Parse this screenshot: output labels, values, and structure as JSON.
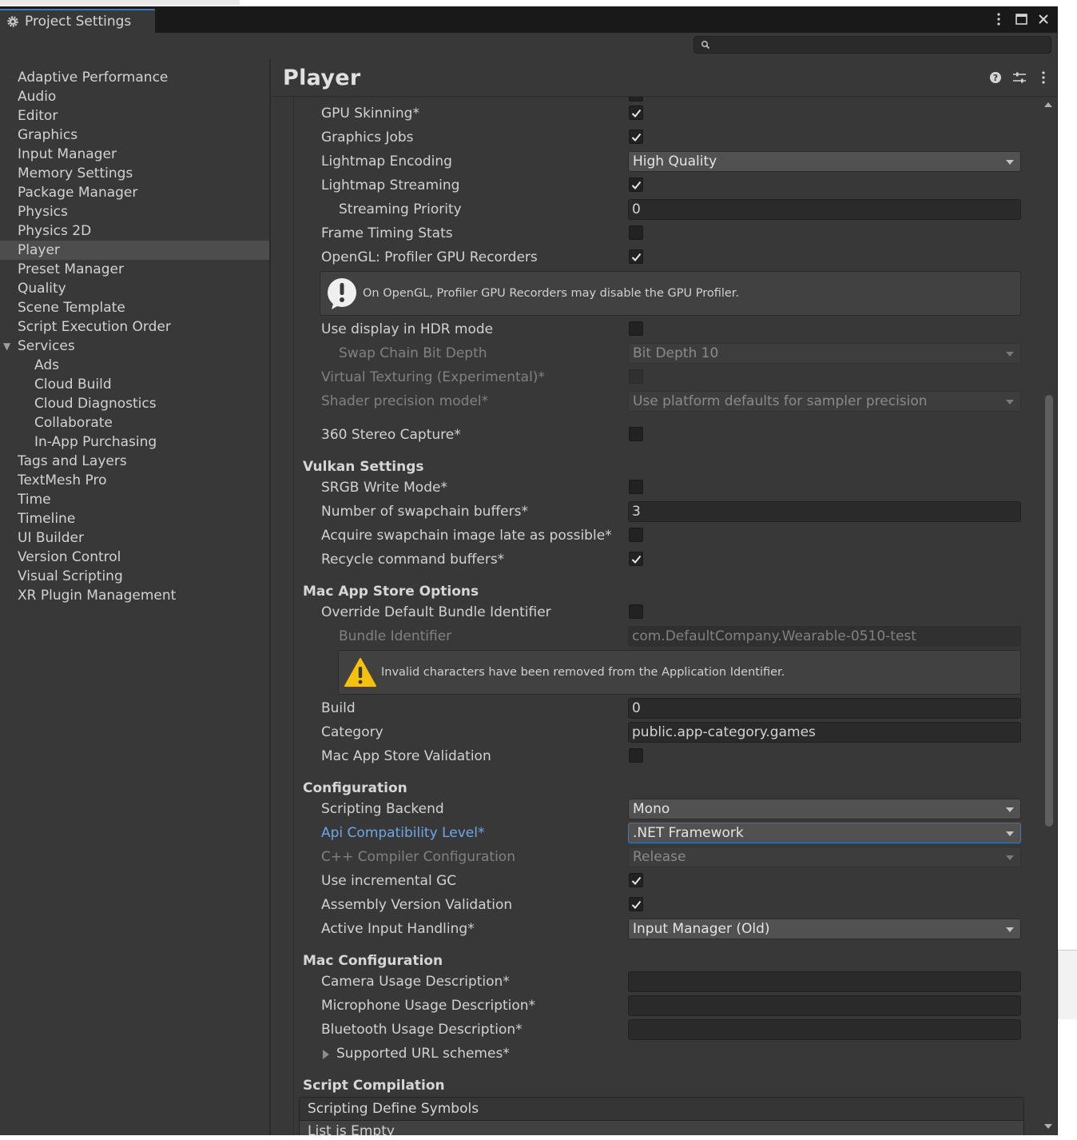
{
  "window": {
    "tab_title": "Project Settings",
    "tab_icon": "gear-icon",
    "controls": [
      "kebab-menu-icon",
      "maximize-icon",
      "close-icon"
    ]
  },
  "search": {
    "placeholder": ""
  },
  "sidebar": {
    "items": [
      {
        "label": "Adaptive Performance"
      },
      {
        "label": "Audio"
      },
      {
        "label": "Editor"
      },
      {
        "label": "Graphics"
      },
      {
        "label": "Input Manager"
      },
      {
        "label": "Memory Settings"
      },
      {
        "label": "Package Manager"
      },
      {
        "label": "Physics"
      },
      {
        "label": "Physics 2D"
      },
      {
        "label": "Player",
        "selected": true
      },
      {
        "label": "Preset Manager"
      },
      {
        "label": "Quality"
      },
      {
        "label": "Scene Template"
      },
      {
        "label": "Script Execution Order"
      },
      {
        "label": "Services",
        "expanded": true
      },
      {
        "label": "Ads",
        "child": true
      },
      {
        "label": "Cloud Build",
        "child": true
      },
      {
        "label": "Cloud Diagnostics",
        "child": true
      },
      {
        "label": "Collaborate",
        "child": true
      },
      {
        "label": "In-App Purchasing",
        "child": true
      },
      {
        "label": "Tags and Layers"
      },
      {
        "label": "TextMesh Pro"
      },
      {
        "label": "Time"
      },
      {
        "label": "Timeline"
      },
      {
        "label": "UI Builder"
      },
      {
        "label": "Version Control"
      },
      {
        "label": "Visual Scripting"
      },
      {
        "label": "XR Plugin Management"
      }
    ]
  },
  "main": {
    "title": "Player",
    "header_icons": [
      "help-icon",
      "preset-icon",
      "kebab-menu-icon"
    ],
    "rows": {
      "gpu_skinning": {
        "label": "GPU Skinning*",
        "checked": true
      },
      "graphics_jobs": {
        "label": "Graphics Jobs",
        "checked": true
      },
      "lightmap_encoding": {
        "label": "Lightmap Encoding",
        "value": "High Quality"
      },
      "lightmap_streaming": {
        "label": "Lightmap Streaming",
        "checked": true
      },
      "streaming_priority": {
        "label": "Streaming Priority",
        "value": "0"
      },
      "frame_timing": {
        "label": "Frame Timing Stats",
        "checked": false
      },
      "opengl_profiler": {
        "label": "OpenGL: Profiler GPU Recorders",
        "checked": true
      },
      "opengl_help": "On OpenGL, Profiler GPU Recorders may disable the GPU Profiler.",
      "hdr_mode": {
        "label": "Use display in HDR mode",
        "checked": false
      },
      "swap_chain": {
        "label": "Swap Chain Bit Depth",
        "value": "Bit Depth 10"
      },
      "virtual_texturing": {
        "label": "Virtual Texturing (Experimental)*",
        "checked": false
      },
      "shader_precision": {
        "label": "Shader precision model*",
        "value": "Use platform defaults for sampler precision"
      },
      "stereo_capture": {
        "label": "360 Stereo Capture*",
        "checked": false
      }
    },
    "vulkan": {
      "header": "Vulkan Settings",
      "srgb": {
        "label": "SRGB Write Mode*",
        "checked": false
      },
      "swapchain_buffers": {
        "label": "Number of swapchain buffers*",
        "value": "3"
      },
      "acquire_late": {
        "label": "Acquire swapchain image late as possible*",
        "checked": false
      },
      "recycle": {
        "label": "Recycle command buffers*",
        "checked": true
      }
    },
    "mac_app_store": {
      "header": "Mac App Store Options",
      "override_bundle": {
        "label": "Override Default Bundle Identifier",
        "checked": false
      },
      "bundle_id": {
        "label": "Bundle Identifier",
        "value": "com.DefaultCompany.Wearable-0510-test"
      },
      "warning": "Invalid characters have been removed from the Application Identifier.",
      "build": {
        "label": "Build",
        "value": "0"
      },
      "category": {
        "label": "Category",
        "value": "public.app-category.games"
      },
      "validation": {
        "label": "Mac App Store Validation",
        "checked": false
      }
    },
    "configuration": {
      "header": "Configuration",
      "scripting_backend": {
        "label": "Scripting Backend",
        "value": "Mono"
      },
      "api_level": {
        "label": "Api Compatibility Level*",
        "value": ".NET Framework"
      },
      "cpp_config": {
        "label": "C++ Compiler Configuration",
        "value": "Release"
      },
      "incremental_gc": {
        "label": "Use incremental GC",
        "checked": true
      },
      "assembly_validation": {
        "label": "Assembly Version Validation",
        "checked": true
      },
      "input_handling": {
        "label": "Active Input Handling*",
        "value": "Input Manager (Old)"
      }
    },
    "mac_config": {
      "header": "Mac Configuration",
      "camera": {
        "label": "Camera Usage Description*",
        "value": ""
      },
      "microphone": {
        "label": "Microphone Usage Description*",
        "value": ""
      },
      "bluetooth": {
        "label": "Bluetooth Usage Description*",
        "value": ""
      },
      "url_schemes": {
        "label": "Supported URL schemes*"
      }
    },
    "script_compilation": {
      "header": "Script Compilation",
      "define_symbols": "Scripting Define Symbols",
      "list_empty": "List is Empty"
    }
  },
  "colors": {
    "window_bg": "#383838",
    "titlebar_bg": "#191919",
    "selected_item": "#4d4d4d",
    "accent_blue": "#3a79bb",
    "link_label": "#6ca7e8",
    "warning_yellow": "#f4c20d"
  }
}
